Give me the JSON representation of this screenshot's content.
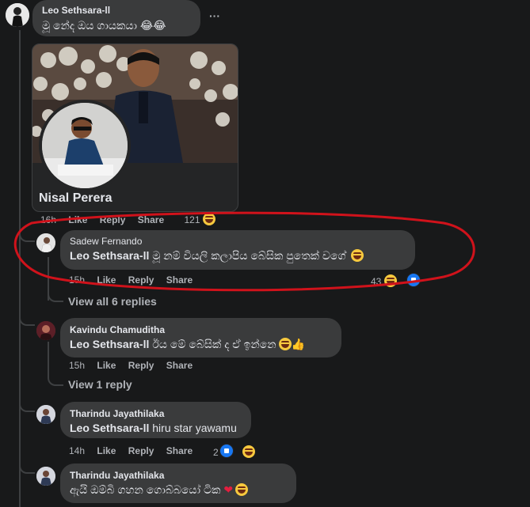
{
  "comments": [
    {
      "author": "Leo Sethsara-ll",
      "text": "මූ නේද ඔය ගායකයා 😂😂"
    },
    {
      "card_name": "Nisal Perera",
      "meta": {
        "time": "16h",
        "like": "Like",
        "reply": "Reply",
        "share": "Share",
        "reactions": "121"
      }
    },
    {
      "author": "Sadew Fernando",
      "mention": "Leo Sethsara-ll",
      "text": "මූ නම් වියලි කලාපිය බේසික පුතෙක් වගේ",
      "meta": {
        "time": "15h",
        "like": "Like",
        "reply": "Reply",
        "share": "Share",
        "reactions": "43"
      },
      "view_replies": "View all 6 replies"
    },
    {
      "author": "Kavindu Chamuditha",
      "mention": "Leo Sethsara-ll",
      "text": "ඊය මේ බේසික් ද ඒ ඉන්නෙ",
      "meta": {
        "time": "15h",
        "like": "Like",
        "reply": "Reply",
        "share": "Share"
      },
      "view_replies": "View 1 reply"
    },
    {
      "author": "Tharindu Jayathilaka",
      "mention": "Leo Sethsara-ll",
      "text": "hiru star yawamu",
      "meta": {
        "time": "14h",
        "like": "Like",
        "reply": "Reply",
        "share": "Share",
        "reactions": "2"
      }
    },
    {
      "author": "Tharindu Jayathilaka",
      "text": "ඇයි ඔම්බි ගහන ගොබ්බයෝ ටික"
    }
  ],
  "more_options": "···",
  "colors": {
    "background": "#18191a",
    "bubble": "#3a3b3c",
    "annotation": "#d0121b",
    "link": "#b0b3b8"
  }
}
